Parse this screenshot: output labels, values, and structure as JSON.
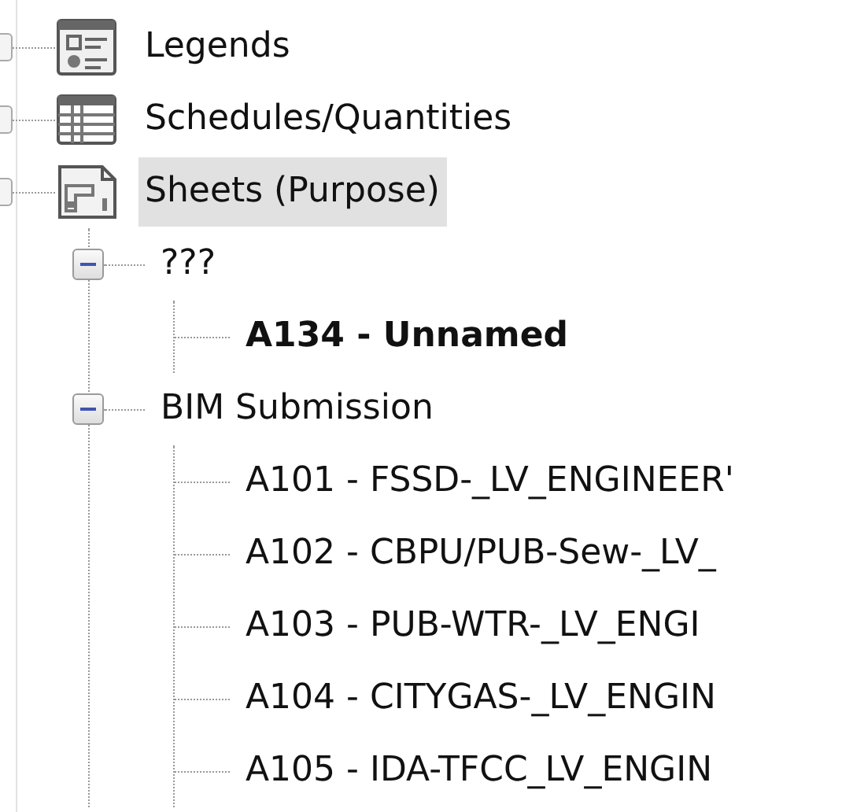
{
  "tree": [
    {
      "kind": "legend",
      "label": "Legends",
      "selected": false
    },
    {
      "kind": "schedule",
      "label": "Schedules/Quantities",
      "selected": false
    },
    {
      "kind": "sheets",
      "label": "Sheets (Purpose)",
      "selected": true,
      "children": [
        {
          "kind": "group",
          "label": "???",
          "expanded": true,
          "children": [
            {
              "kind": "view",
              "label": "A134 - Unnamed",
              "active": true
            }
          ]
        },
        {
          "kind": "group",
          "label": "BIM Submission",
          "expanded": true,
          "children": [
            {
              "kind": "view",
              "label": "A101 - FSSD-_LV_ENGINEER'",
              "active": false
            },
            {
              "kind": "view",
              "label": "A102 - CBPU/PUB-Sew-_LV_",
              "active": false
            },
            {
              "kind": "view",
              "label": "A103 - PUB-WTR-_LV_ENGI",
              "active": false
            },
            {
              "kind": "view",
              "label": "A104 - CITYGAS-_LV_ENGIN",
              "active": false
            },
            {
              "kind": "view",
              "label": "A105 - IDA-TFCC_LV_ENGIN",
              "active": false
            }
          ]
        }
      ]
    }
  ]
}
